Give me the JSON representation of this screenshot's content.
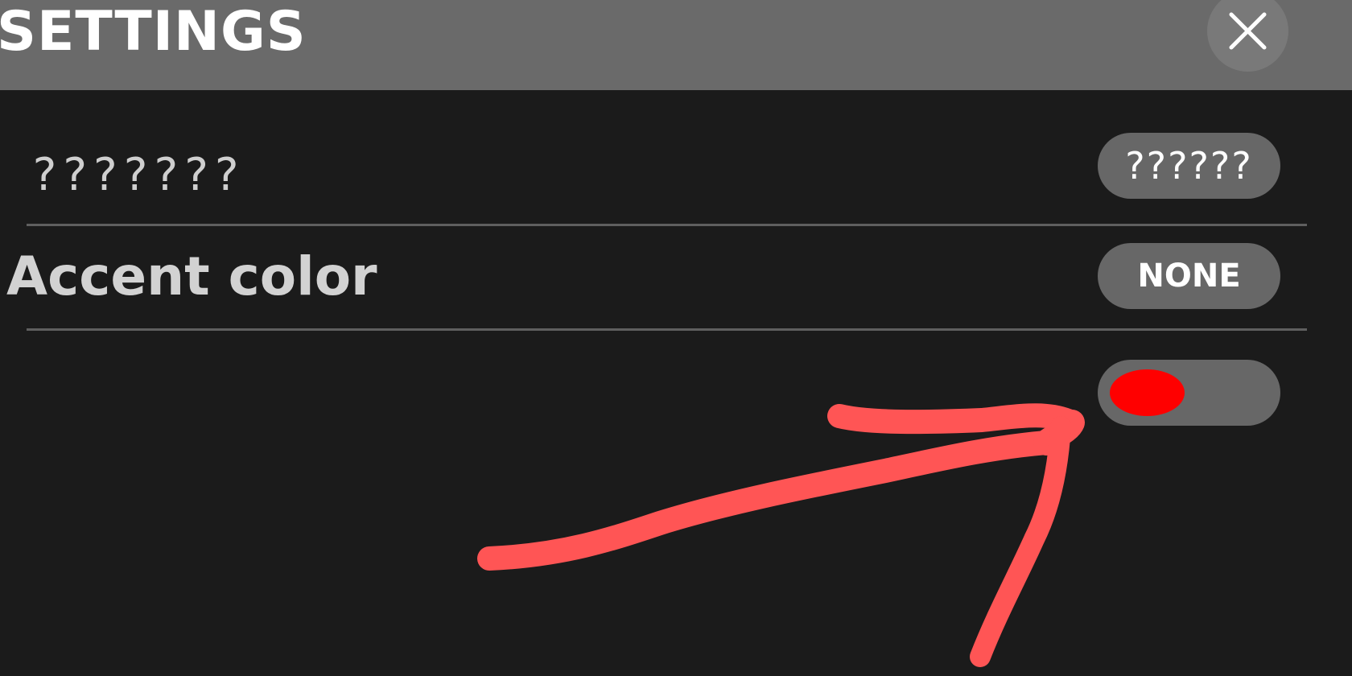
{
  "header": {
    "title": "SETTINGS",
    "close_icon": "close-icon"
  },
  "rows": [
    {
      "label": "???????",
      "button_label": "??????"
    },
    {
      "label": "Accent color",
      "button_label": "NONE"
    }
  ],
  "toggle": {
    "state": "off",
    "knob_color": "#ff0000"
  },
  "annotation": {
    "icon": "arrow-annotation-icon",
    "color": "#ff5555"
  },
  "colors": {
    "background": "#1b1b1b",
    "header": "#6a6a6a",
    "pill": "#676767"
  }
}
